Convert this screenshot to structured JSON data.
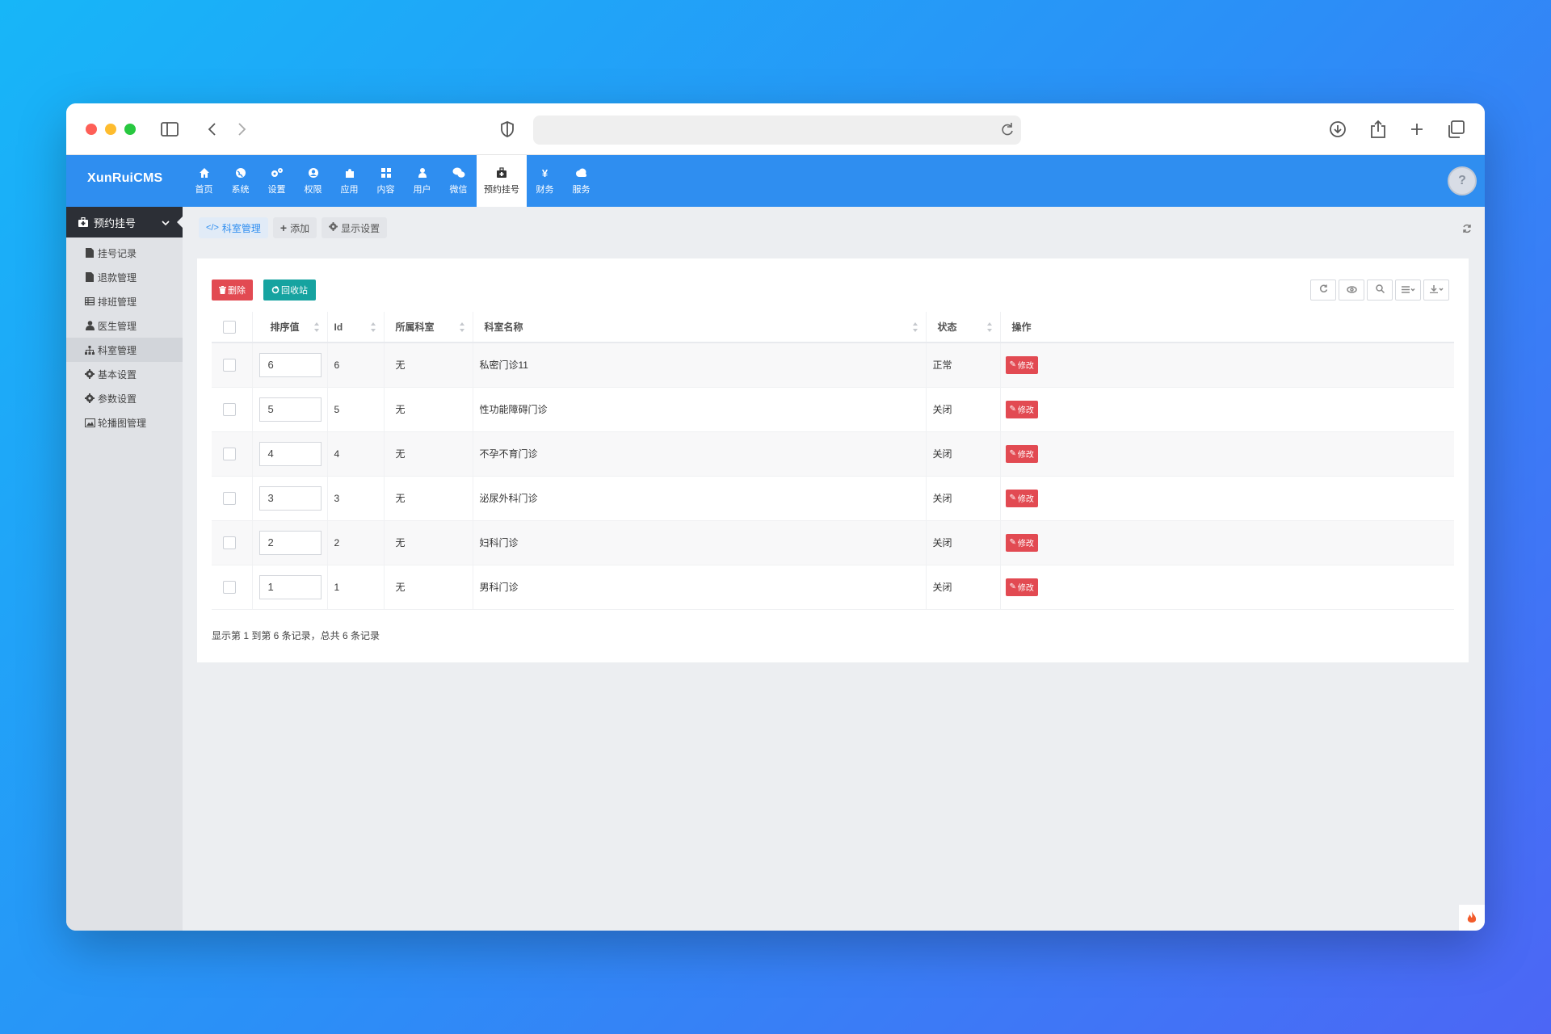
{
  "app": {
    "logo": "XunRuiCMS",
    "nav": [
      {
        "label": "首页",
        "icon": "home-icon"
      },
      {
        "label": "系统",
        "icon": "globe-icon"
      },
      {
        "label": "设置",
        "icon": "gears-icon"
      },
      {
        "label": "权限",
        "icon": "user-circle-icon"
      },
      {
        "label": "应用",
        "icon": "puzzle-icon"
      },
      {
        "label": "内容",
        "icon": "grid-icon"
      },
      {
        "label": "用户",
        "icon": "user-icon"
      },
      {
        "label": "微信",
        "icon": "wechat-icon"
      },
      {
        "label": "预约挂号",
        "icon": "medkit-icon",
        "active": true
      },
      {
        "label": "财务",
        "icon": "yen-icon"
      },
      {
        "label": "服务",
        "icon": "cloud-icon"
      }
    ]
  },
  "sidebar": {
    "header": "预约挂号",
    "items": [
      {
        "label": "挂号记录",
        "icon": "file-icon"
      },
      {
        "label": "退款管理",
        "icon": "file-icon"
      },
      {
        "label": "排班管理",
        "icon": "table-icon"
      },
      {
        "label": "医生管理",
        "icon": "user-icon"
      },
      {
        "label": "科室管理",
        "icon": "sitemap-icon",
        "active": true
      },
      {
        "label": "基本设置",
        "icon": "gear-icon"
      },
      {
        "label": "参数设置",
        "icon": "gear-icon"
      },
      {
        "label": "轮播图管理",
        "icon": "image-icon"
      }
    ]
  },
  "tabs": [
    {
      "label": "科室管理",
      "icon": "code-icon",
      "active": true
    },
    {
      "label": "添加",
      "icon": "plus-icon"
    },
    {
      "label": "显示设置",
      "icon": "gear-icon"
    }
  ],
  "actions": {
    "delete": "删除",
    "recycle": "回收站"
  },
  "table": {
    "headers": [
      "排序值",
      "Id",
      "所属科室",
      "科室名称",
      "状态",
      "操作"
    ],
    "rows": [
      {
        "sort": "6",
        "id": "6",
        "parent": "无",
        "name": "私密门诊11",
        "status": "正常",
        "action": "修改"
      },
      {
        "sort": "5",
        "id": "5",
        "parent": "无",
        "name": "性功能障碍门诊",
        "status": "关闭",
        "action": "修改"
      },
      {
        "sort": "4",
        "id": "4",
        "parent": "无",
        "name": "不孕不育门诊",
        "status": "关闭",
        "action": "修改"
      },
      {
        "sort": "3",
        "id": "3",
        "parent": "无",
        "name": "泌尿外科门诊",
        "status": "关闭",
        "action": "修改"
      },
      {
        "sort": "2",
        "id": "2",
        "parent": "无",
        "name": "妇科门诊",
        "status": "关闭",
        "action": "修改"
      },
      {
        "sort": "1",
        "id": "1",
        "parent": "无",
        "name": "男科门诊",
        "status": "关闭",
        "action": "修改"
      }
    ]
  },
  "pager": "显示第 1 到第 6 条记录，总共 6 条记录",
  "colors": {
    "primary": "#2f8ef0",
    "danger": "#e24a52",
    "teal": "#16a3a0",
    "sidebar_dark": "#2c2f36"
  }
}
